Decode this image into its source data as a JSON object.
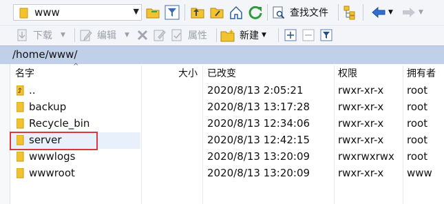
{
  "toolbar": {
    "path_combo_value": "www",
    "search_label": "查找文件",
    "download_label": "下载",
    "edit_label": "编辑",
    "properties_label": "属性",
    "new_label": "新建"
  },
  "colors": {
    "path_bar_bg": "#bfd0e8",
    "folder_yellow": "#f2c230",
    "selection_box": "#d9363e"
  },
  "path": "/home/www/",
  "columns": {
    "name": "名字",
    "size": "大小",
    "modified": "已改变",
    "permissions": "权限",
    "owner": "拥有者"
  },
  "rows": [
    {
      "name": "..",
      "modified": "2020/8/13 2:05:21",
      "permissions": "rwxr-xr-x",
      "owner": "root",
      "icon": "parent-folder-icon"
    },
    {
      "name": "backup",
      "modified": "2020/8/13 13:17:28",
      "permissions": "rwxr-xr-x",
      "owner": "root",
      "icon": "folder-icon"
    },
    {
      "name": "Recycle_bin",
      "modified": "2020/8/13 12:34:06",
      "permissions": "rwxr-xr-x",
      "owner": "root",
      "icon": "folder-icon"
    },
    {
      "name": "server",
      "modified": "2020/8/13 12:42:15",
      "permissions": "rwxr-xr-x",
      "owner": "root",
      "icon": "folder-icon"
    },
    {
      "name": "wwwlogs",
      "modified": "2020/8/13 13:20:09",
      "permissions": "rwxrwxrwx",
      "owner": "root",
      "icon": "folder-icon"
    },
    {
      "name": "wwwroot",
      "modified": "2020/8/13 13:20:09",
      "permissions": "rwxr-xr-x",
      "owner": "www",
      "icon": "folder-icon"
    }
  ]
}
